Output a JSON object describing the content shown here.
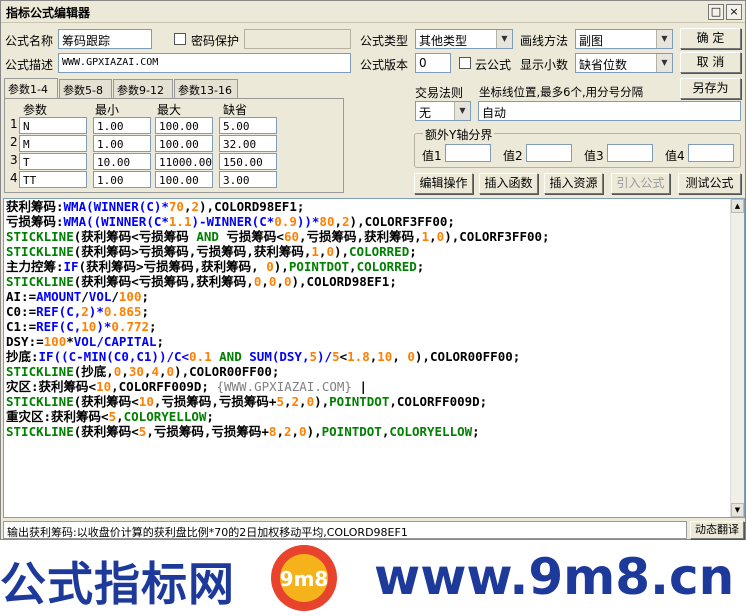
{
  "window": {
    "title": "指标公式编辑器",
    "max_glyph": "□",
    "close_glyph": "×"
  },
  "form": {
    "name_label": "公式名称",
    "name_value": "筹码跟踪",
    "password_label": "密码保护",
    "desc_label": "公式描述",
    "desc_value": "WWW.GPXIAZAI.COM",
    "type_label": "公式类型",
    "type_value": "其他类型",
    "draw_label": "画线方法",
    "draw_value": "副图",
    "version_label": "公式版本",
    "version_value": "0",
    "cloud_label": "云公式",
    "decimals_label": "显示小数",
    "decimals_value": "缺省位数"
  },
  "buttons": {
    "ok": "确  定",
    "cancel": "取  消",
    "save_as": "另存为",
    "edit_op": "编辑操作",
    "insert_fn": "插入函数",
    "insert_res": "插入资源",
    "import": "引入公式",
    "test": "测试公式",
    "translate": "动态翻译"
  },
  "tabs": [
    "参数1-4",
    "参数5-8",
    "参数9-12",
    "参数13-16"
  ],
  "params": {
    "headers": [
      "参数",
      "最小",
      "最大",
      "缺省"
    ],
    "rows": [
      {
        "idx": "1",
        "name": "N",
        "min": "1.00",
        "max": "100.00",
        "def": "5.00"
      },
      {
        "idx": "2",
        "name": "M",
        "min": "1.00",
        "max": "100.00",
        "def": "32.00"
      },
      {
        "idx": "3",
        "name": "T",
        "min": "10.00",
        "max": "11000.00",
        "def": "150.00"
      },
      {
        "idx": "4",
        "name": "TT",
        "min": "1.00",
        "max": "100.00",
        "def": "3.00"
      }
    ]
  },
  "trade": {
    "rule_label": "交易法则",
    "rule_value": "无",
    "coord_label": "坐标线位置,最多6个,用分号分隔",
    "coord_value": "自动"
  },
  "yaxis": {
    "group_label": "额外Y轴分界",
    "labels": [
      "值1",
      "值2",
      "值3",
      "值4"
    ]
  },
  "code_lines": [
    [
      {
        "t": "获利筹码:",
        "c": "k-name"
      },
      {
        "t": "WMA(WINNER(C)*",
        "c": "k-fn"
      },
      {
        "t": "70",
        "c": "k-num"
      },
      {
        "t": ",",
        "c": "k-name"
      },
      {
        "t": "2",
        "c": "k-num"
      },
      {
        "t": "),COLORD98EF1;",
        "c": "k-name"
      }
    ],
    [
      {
        "t": "亏损筹码:",
        "c": "k-name"
      },
      {
        "t": "WMA((WINNER(C*",
        "c": "k-fn"
      },
      {
        "t": "1.1",
        "c": "k-num"
      },
      {
        "t": ")-WINNER(C*",
        "c": "k-fn"
      },
      {
        "t": "0.9",
        "c": "k-num"
      },
      {
        "t": "))*",
        "c": "k-fn"
      },
      {
        "t": "80",
        "c": "k-num"
      },
      {
        "t": ",",
        "c": "k-name"
      },
      {
        "t": "2",
        "c": "k-num"
      },
      {
        "t": "),COLORF3FF00;",
        "c": "k-name"
      }
    ],
    [
      {
        "t": "STICKLINE",
        "c": "k-clr"
      },
      {
        "t": "(获利筹码<亏损筹码 ",
        "c": "k-name"
      },
      {
        "t": "AND",
        "c": "k-clr"
      },
      {
        "t": " 亏损筹码<",
        "c": "k-name"
      },
      {
        "t": "60",
        "c": "k-num"
      },
      {
        "t": ",亏损筹码,获利筹码,",
        "c": "k-name"
      },
      {
        "t": "1",
        "c": "k-num"
      },
      {
        "t": ",",
        "c": "k-name"
      },
      {
        "t": "0",
        "c": "k-num"
      },
      {
        "t": "),COLORF3FF00;",
        "c": "k-name"
      }
    ],
    [
      {
        "t": "STICKLINE",
        "c": "k-clr"
      },
      {
        "t": "(获利筹码>亏损筹码,亏损筹码,获利筹码,",
        "c": "k-name"
      },
      {
        "t": "1",
        "c": "k-num"
      },
      {
        "t": ",",
        "c": "k-name"
      },
      {
        "t": "0",
        "c": "k-num"
      },
      {
        "t": "),",
        "c": "k-name"
      },
      {
        "t": "COLORRED",
        "c": "k-clr"
      },
      {
        "t": ";",
        "c": "k-name"
      }
    ],
    [
      {
        "t": "主力控筹:",
        "c": "k-name"
      },
      {
        "t": "IF",
        "c": "k-fn"
      },
      {
        "t": "(获利筹码>亏损筹码,获利筹码, ",
        "c": "k-name"
      },
      {
        "t": "0",
        "c": "k-num"
      },
      {
        "t": "),",
        "c": "k-name"
      },
      {
        "t": "POINTDOT",
        "c": "k-clr"
      },
      {
        "t": ",",
        "c": "k-name"
      },
      {
        "t": "COLORRED",
        "c": "k-clr"
      },
      {
        "t": ";",
        "c": "k-name"
      }
    ],
    [
      {
        "t": "STICKLINE",
        "c": "k-clr"
      },
      {
        "t": "(获利筹码<亏损筹码,获利筹码,",
        "c": "k-name"
      },
      {
        "t": "0",
        "c": "k-num"
      },
      {
        "t": ",",
        "c": "k-name"
      },
      {
        "t": "0",
        "c": "k-num"
      },
      {
        "t": ",",
        "c": "k-name"
      },
      {
        "t": "0",
        "c": "k-num"
      },
      {
        "t": "),COLORD98EF1;",
        "c": "k-name"
      }
    ],
    [
      {
        "t": "AI:=",
        "c": "k-name"
      },
      {
        "t": "AMOUNT",
        "c": "k-fn"
      },
      {
        "t": "/",
        "c": "k-name"
      },
      {
        "t": "VOL",
        "c": "k-fn"
      },
      {
        "t": "/",
        "c": "k-name"
      },
      {
        "t": "100",
        "c": "k-num"
      },
      {
        "t": ";",
        "c": "k-name"
      }
    ],
    [
      {
        "t": "C0:=",
        "c": "k-name"
      },
      {
        "t": "REF(C,",
        "c": "k-fn"
      },
      {
        "t": "2",
        "c": "k-num"
      },
      {
        "t": ")*",
        "c": "k-fn"
      },
      {
        "t": "0.865",
        "c": "k-num"
      },
      {
        "t": ";",
        "c": "k-name"
      }
    ],
    [
      {
        "t": "C1:=",
        "c": "k-name"
      },
      {
        "t": "REF(C,",
        "c": "k-fn"
      },
      {
        "t": "10",
        "c": "k-num"
      },
      {
        "t": ")*",
        "c": "k-fn"
      },
      {
        "t": "0.772",
        "c": "k-num"
      },
      {
        "t": ";",
        "c": "k-name"
      }
    ],
    [
      {
        "t": "DSY:=",
        "c": "k-name"
      },
      {
        "t": "100",
        "c": "k-num"
      },
      {
        "t": "*",
        "c": "k-name"
      },
      {
        "t": "VOL/CAPITAL",
        "c": "k-fn"
      },
      {
        "t": ";",
        "c": "k-name"
      }
    ],
    [
      {
        "t": "抄底:",
        "c": "k-name"
      },
      {
        "t": "IF((C-MIN(C0,C1))/C<",
        "c": "k-fn"
      },
      {
        "t": "0.1",
        "c": "k-num"
      },
      {
        "t": " AND ",
        "c": "k-clr"
      },
      {
        "t": "SUM(DSY,",
        "c": "k-fn"
      },
      {
        "t": "5",
        "c": "k-num"
      },
      {
        "t": ")/",
        "c": "k-fn"
      },
      {
        "t": "5",
        "c": "k-num"
      },
      {
        "t": "<",
        "c": "k-name"
      },
      {
        "t": "1.8",
        "c": "k-num"
      },
      {
        "t": ",",
        "c": "k-name"
      },
      {
        "t": "10",
        "c": "k-num"
      },
      {
        "t": ", ",
        "c": "k-name"
      },
      {
        "t": "0",
        "c": "k-num"
      },
      {
        "t": "),COLOR00FF00;",
        "c": "k-name"
      }
    ],
    [
      {
        "t": "STICKLINE",
        "c": "k-clr"
      },
      {
        "t": "(抄底,",
        "c": "k-name"
      },
      {
        "t": "0",
        "c": "k-num"
      },
      {
        "t": ",",
        "c": "k-name"
      },
      {
        "t": "30",
        "c": "k-num"
      },
      {
        "t": ",",
        "c": "k-name"
      },
      {
        "t": "4",
        "c": "k-num"
      },
      {
        "t": ",",
        "c": "k-name"
      },
      {
        "t": "0",
        "c": "k-num"
      },
      {
        "t": "),COLOR00FF00;",
        "c": "k-name"
      }
    ],
    [
      {
        "t": "灾区:获利筹码<",
        "c": "k-name"
      },
      {
        "t": "10",
        "c": "k-num"
      },
      {
        "t": ",COLORFF009D; ",
        "c": "k-name"
      },
      {
        "t": "{WWW.GPXIAZAI.COM}",
        "c": "k-cmt"
      },
      {
        "t": " |",
        "c": "k-name"
      }
    ],
    [
      {
        "t": "STICKLINE",
        "c": "k-clr"
      },
      {
        "t": "(获利筹码<",
        "c": "k-name"
      },
      {
        "t": "10",
        "c": "k-num"
      },
      {
        "t": ",亏损筹码,亏损筹码+",
        "c": "k-name"
      },
      {
        "t": "5",
        "c": "k-num"
      },
      {
        "t": ",",
        "c": "k-name"
      },
      {
        "t": "2",
        "c": "k-num"
      },
      {
        "t": ",",
        "c": "k-name"
      },
      {
        "t": "0",
        "c": "k-num"
      },
      {
        "t": "),",
        "c": "k-name"
      },
      {
        "t": "POINTDOT",
        "c": "k-clr"
      },
      {
        "t": ",COLORFF009D;",
        "c": "k-name"
      }
    ],
    [
      {
        "t": "重灾区:获利筹码<",
        "c": "k-name"
      },
      {
        "t": "5",
        "c": "k-num"
      },
      {
        "t": ",",
        "c": "k-name"
      },
      {
        "t": "COLORYELLOW",
        "c": "k-clr"
      },
      {
        "t": ";",
        "c": "k-name"
      }
    ],
    [
      {
        "t": "STICKLINE",
        "c": "k-clr"
      },
      {
        "t": "(获利筹码<",
        "c": "k-name"
      },
      {
        "t": "5",
        "c": "k-num"
      },
      {
        "t": ",亏损筹码,亏损筹码+",
        "c": "k-name"
      },
      {
        "t": "8",
        "c": "k-num"
      },
      {
        "t": ",",
        "c": "k-name"
      },
      {
        "t": "2",
        "c": "k-num"
      },
      {
        "t": ",",
        "c": "k-name"
      },
      {
        "t": "0",
        "c": "k-num"
      },
      {
        "t": "),",
        "c": "k-name"
      },
      {
        "t": "POINTDOT",
        "c": "k-clr"
      },
      {
        "t": ",",
        "c": "k-name"
      },
      {
        "t": "COLORYELLOW",
        "c": "k-clr"
      },
      {
        "t": ";",
        "c": "k-name"
      }
    ]
  ],
  "status": "输出获利筹码:以收盘价计算的获利盘比例*70的2日加权移动平均,COLORD98EF1",
  "banner": {
    "cn": "公式指标网",
    "url": "www.9m8.cn",
    "logo_text": "9m8"
  },
  "colors": {
    "accent": "#1d3a9a",
    "panel": "#ece9d8"
  }
}
